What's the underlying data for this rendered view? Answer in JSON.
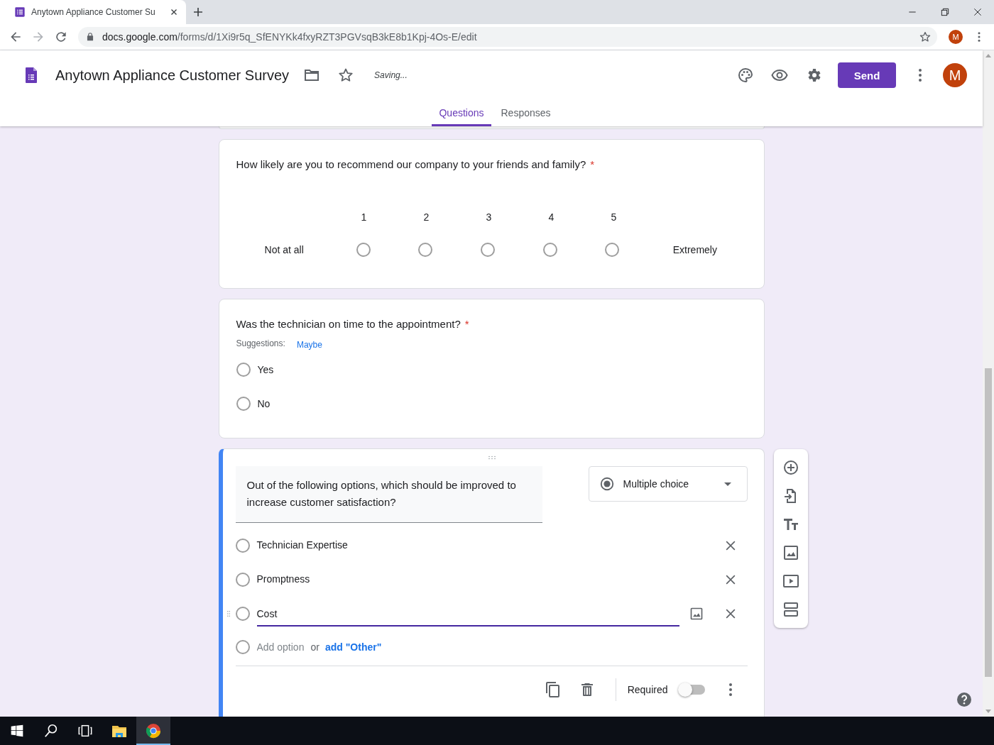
{
  "browser": {
    "tab_title": "Anytown Appliance Customer Su",
    "url_domain": "docs.google.com",
    "url_path": "/forms/d/1Xi9r5q_SfENYKk4fxyRZT3PGVsqB3kE8b1Kpj-4Os-E/edit",
    "profile_initial": "M"
  },
  "header": {
    "title": "Anytown Appliance Customer Survey",
    "status": "Saving...",
    "send_label": "Send",
    "avatar_initial": "M"
  },
  "tabs": [
    {
      "label": "Questions",
      "selected": true
    },
    {
      "label": "Responses",
      "selected": false
    }
  ],
  "questions": [
    {
      "kind": "scale",
      "title": "How likely are you to recommend our company to your friends and family?",
      "required": true,
      "required_mark": "*",
      "points": [
        {
          "label": "1",
          "selected": false
        },
        {
          "label": "2",
          "selected": false
        },
        {
          "label": "3",
          "selected": false
        },
        {
          "label": "4",
          "selected": false
        },
        {
          "label": "5",
          "selected": false
        }
      ],
      "low_label": "Not at all",
      "high_label": "Extremely"
    },
    {
      "kind": "choice",
      "title": "Was the technician on time to the appointment?",
      "required": true,
      "required_mark": "*",
      "suggestions_label": "Suggestions:",
      "suggestions": [
        "Maybe"
      ],
      "options": [
        {
          "text": "Yes",
          "selected": false
        },
        {
          "text": "No",
          "selected": false
        }
      ]
    },
    {
      "kind": "edit",
      "title": "Out of the following options, which should be improved to increase customer satisfaction?",
      "type_label": "Multiple choice",
      "options": [
        {
          "text": "Technician Expertise",
          "selected": false,
          "focused": false
        },
        {
          "text": "Promptness",
          "selected": false,
          "focused": false
        },
        {
          "text": "Cost",
          "selected": false,
          "focused": true
        }
      ],
      "add_option_placeholder": "Add option",
      "or_text": "or",
      "add_other_label": "add \"Other\"",
      "required_label": "Required",
      "required": false
    }
  ]
}
